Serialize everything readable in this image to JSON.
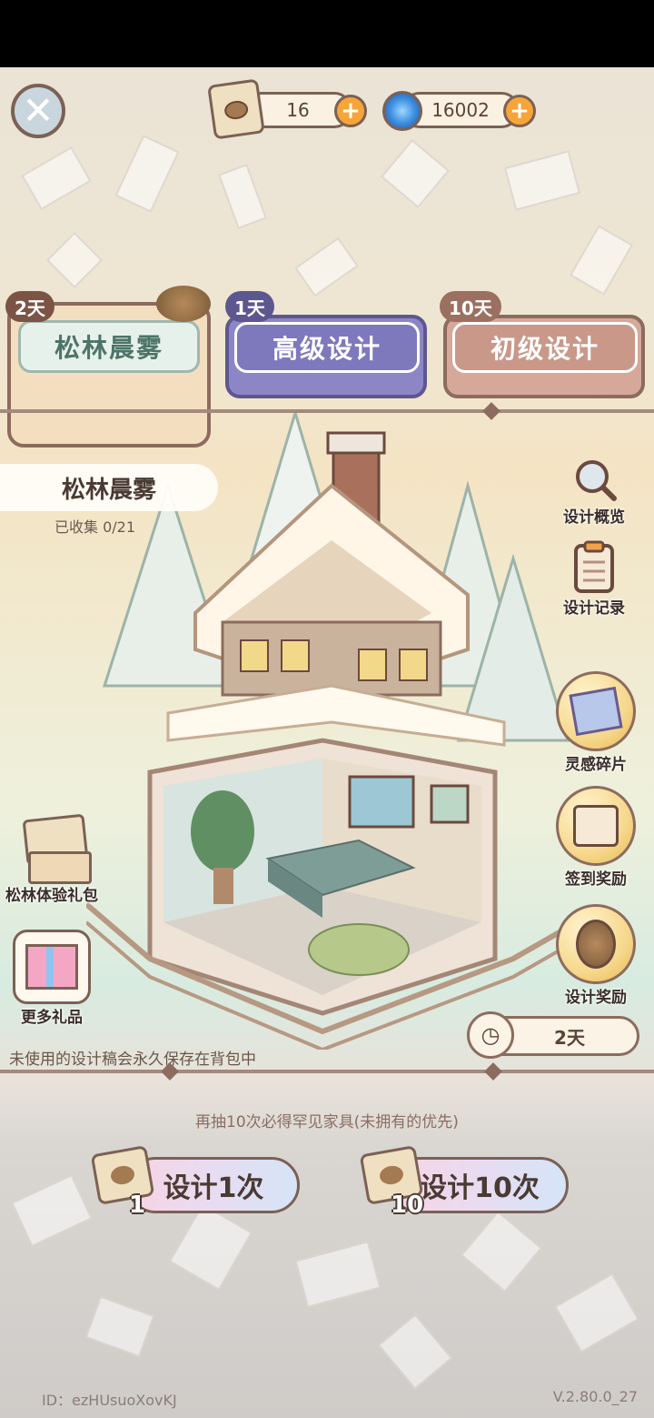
{
  "header": {
    "scroll_count": "16",
    "inspiration_count": "16002"
  },
  "tabs": [
    {
      "badge": "2天",
      "label": "松林晨雾"
    },
    {
      "badge": "1天",
      "label": "高级设计"
    },
    {
      "badge": "10天",
      "label": "初级设计"
    }
  ],
  "banner": {
    "name": "松林晨雾",
    "collected": "已收集 0/21"
  },
  "right_menu": {
    "overview": "设计概览",
    "records": "设计记录",
    "fragments": "灵感碎片",
    "signin": "签到奖励",
    "rewards": "设计奖励"
  },
  "left_menu": {
    "trial_pack": "松林体验礼包",
    "more_gifts": "更多礼品"
  },
  "timer": "2天",
  "notice": "未使用的设计稿会永久保存在背包中",
  "promo": "再抽10次必得罕见家具(未拥有的优先)",
  "draw": {
    "single_label": "设计1次",
    "single_cost": "1",
    "ten_label": "设计10次",
    "ten_cost": "10"
  },
  "footer": {
    "id": "ID：ezHUsuoXovKJ",
    "version": "V.2.80.0_27"
  }
}
